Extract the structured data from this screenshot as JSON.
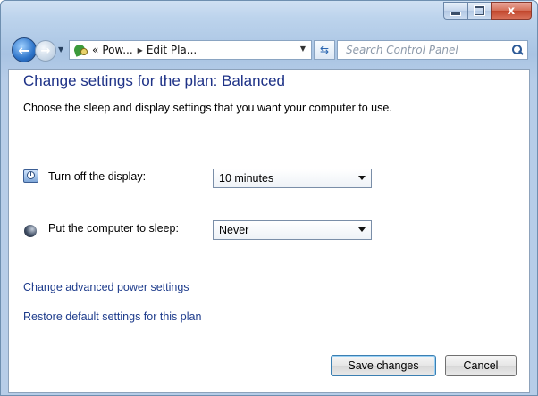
{
  "window": {
    "caption": {
      "minimize": "minimize",
      "maximize": "maximize",
      "close": "x"
    }
  },
  "nav": {
    "back_icon": "back-arrow",
    "forward_icon": "forward-arrow",
    "breadcrumb": {
      "overflow": "«",
      "items": [
        "Pow...",
        "Edit Pla..."
      ]
    },
    "refresh_icon": "refresh-arrows",
    "search": {
      "placeholder": "Search Control Panel",
      "icon": "search-icon"
    }
  },
  "content": {
    "title": "Change settings for the plan: Balanced",
    "description": "Choose the sleep and display settings that you want your computer to use.",
    "settings": [
      {
        "label": "Turn off the display:",
        "value": "10 minutes",
        "icon": "display-clock-icon"
      },
      {
        "label": "Put the computer to sleep:",
        "value": "Never",
        "icon": "moon-icon"
      }
    ],
    "links": {
      "advanced": "Change advanced power settings",
      "restore": "Restore default settings for this plan"
    },
    "buttons": {
      "save": "Save changes",
      "cancel": "Cancel"
    }
  },
  "colors": {
    "title": "#1e3287",
    "link": "#1e3c8c",
    "close_button": "#c1452b"
  }
}
